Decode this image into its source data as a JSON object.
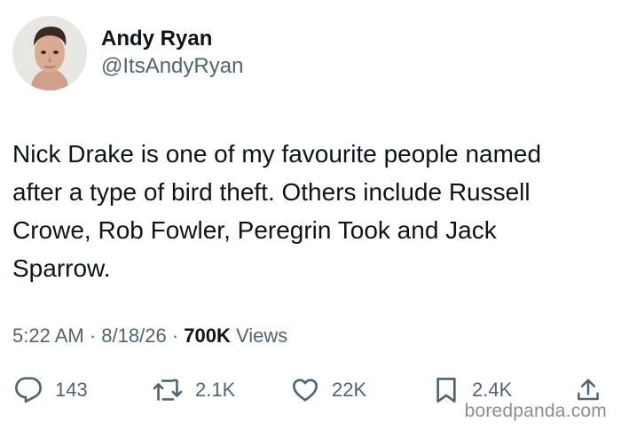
{
  "author": {
    "display_name": "Andy Ryan",
    "handle": "@ItsAndyRyan"
  },
  "tweet_text": "Nick Drake is one of my favourite people named\nafter a type of bird theft. Others include Russell\nCrowe, Rob Fowler, Peregrin Took and Jack\nSparrow.",
  "meta": {
    "time": "5:22 AM",
    "date": "8/18/26",
    "separator": "·",
    "views_count": "700K",
    "views_label": "Views"
  },
  "actions": {
    "replies": "143",
    "reposts": "2.1K",
    "likes": "22K",
    "bookmarks": "2.4K"
  },
  "watermark": "boredpanda.com",
  "colors": {
    "text": "#0f1419",
    "secondary": "#536471",
    "background": "#ffffff"
  },
  "icons": [
    "reply-icon",
    "repost-icon",
    "like-icon",
    "bookmark-icon",
    "share-icon"
  ]
}
